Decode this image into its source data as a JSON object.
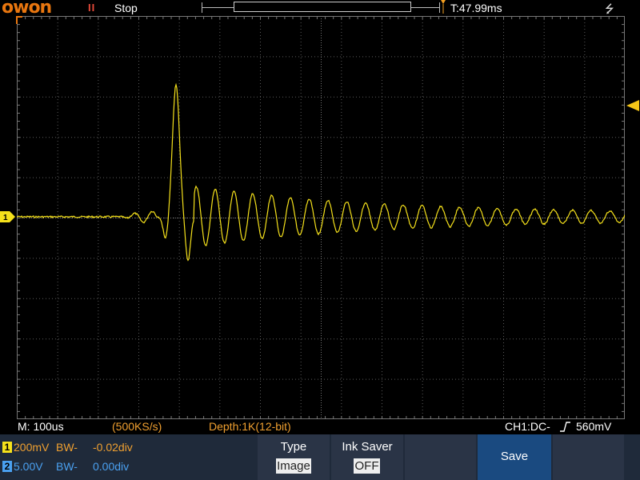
{
  "status": {
    "brand": "owon",
    "run_state": "Stop",
    "trigger_time": "T:47.99ms"
  },
  "info": {
    "timebase": "M: 100us",
    "sample_rate": "(500KS/s)",
    "depth": "Depth:1K(12-bit)",
    "trigger": "CH1:DC-",
    "trigger_level": "560mV"
  },
  "channels": [
    {
      "num": "1",
      "volts": "200mV",
      "bw": "BW-",
      "offset": "-0.02div",
      "color": "#f5e11b"
    },
    {
      "num": "2",
      "volts": "5.00V",
      "bw": "BW-",
      "offset": "0.00div",
      "color": "#4aa0f0"
    }
  ],
  "menu": {
    "type_title": "Type",
    "type_value": "Image",
    "ink_title": "Ink Saver",
    "ink_value": "OFF",
    "save_label": "Save"
  },
  "colors": {
    "trace": "#f5e11b",
    "grid": "#5a5a5a",
    "brand": "#e8760f",
    "trigger_marker": "#f5c518"
  }
}
